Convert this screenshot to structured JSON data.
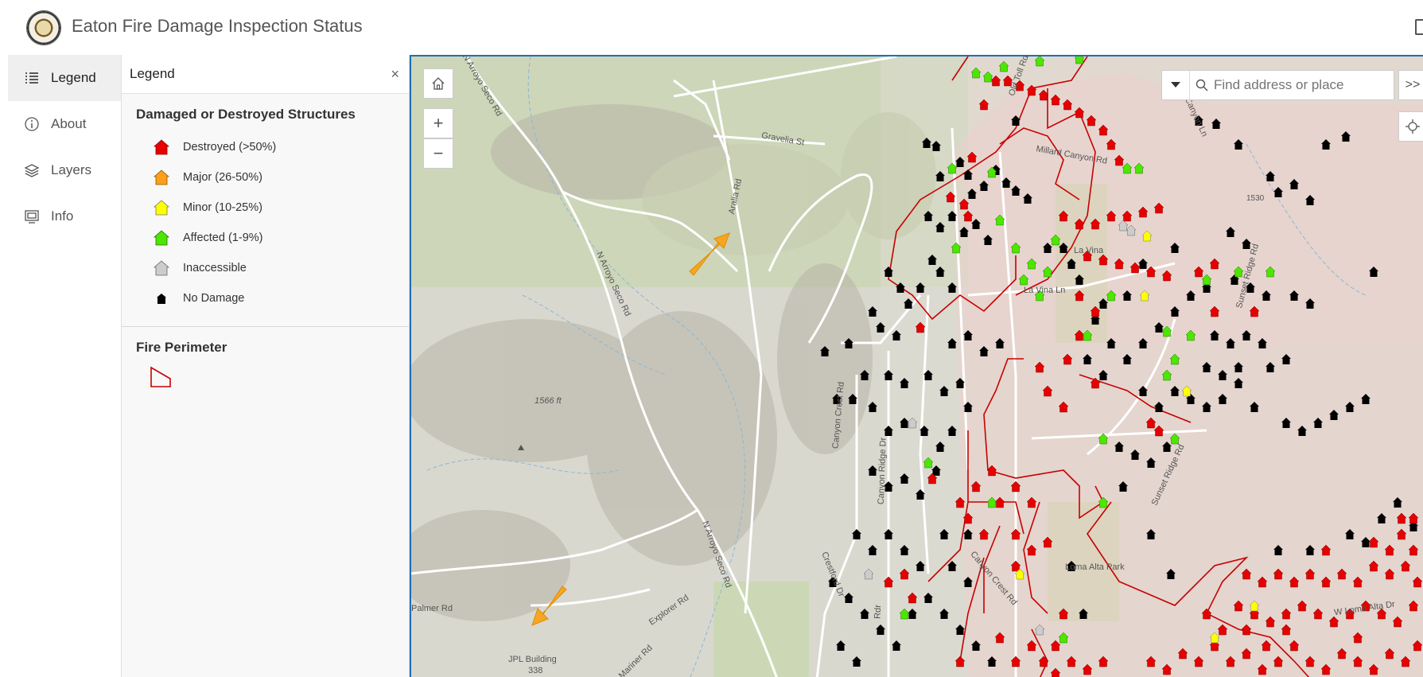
{
  "header": {
    "title": "Eaton Fire Damage Inspection Status"
  },
  "rail": {
    "items": [
      {
        "label": "Legend",
        "icon": "legend-list-icon",
        "active": true
      },
      {
        "label": "About",
        "icon": "info-circle-icon",
        "active": false
      },
      {
        "label": "Layers",
        "icon": "layers-icon",
        "active": false
      },
      {
        "label": "Info",
        "icon": "info-card-icon",
        "active": false
      }
    ]
  },
  "legend": {
    "title": "Legend",
    "close_label": "×",
    "damage_section": {
      "title": "Damaged or Destroyed Structures",
      "items": [
        {
          "label": "Destroyed (>50%)",
          "color": "#e60000"
        },
        {
          "label": "Major (26-50%)",
          "color": "#ff9f1a"
        },
        {
          "label": "Minor (10-25%)",
          "color": "#ffff00"
        },
        {
          "label": "Affected (1-9%)",
          "color": "#4ce600"
        },
        {
          "label": "Inaccessible",
          "color": "#cccccc"
        },
        {
          "label": "No Damage",
          "color": "#000000"
        }
      ]
    },
    "perimeter_section": {
      "title": "Fire Perimeter",
      "color": "#c80000"
    }
  },
  "map": {
    "search_placeholder": "Find address or place",
    "expand_label": ">>",
    "zoom_in": "+",
    "zoom_out": "−",
    "labels": {
      "gravelia": "Gravelia St",
      "aralia": "Aralia Rd",
      "arroyo_top": "N Arroyo Seco Rd",
      "arroyo_mid": "N Arroyo Seco Rd",
      "arroyo_bot": "N Arroyo Seco Rd",
      "old_toll": "Old Toll Rd",
      "canyon_ln": "Canyon Ln",
      "millard": "Millard Canyon Rd",
      "la_vina": "La Vina",
      "la_vina_ln": "La Vina Ln",
      "canyon_crest": "Canyon Crest Rd",
      "canyon_ridge": "Canyon Ridge Dr",
      "sunset_ridge": "Sunset Ridge Rd",
      "sunset_ridge_top": "Sunset Ridge Rd",
      "elev": "1566 ft",
      "jpl": "JPL Building",
      "jpl_num": "338",
      "explorer": "Explorer Rd",
      "mariner": "Mariner Rd",
      "crestford": "Crestford Dr",
      "loma_alta": "Loma Alta Park",
      "w_loma_alta": "W Loma Alta Dr",
      "canyon_crest2": "Canyon Crest Rd",
      "palmer": "Palmer Rd",
      "rdr": "Rdr",
      "num1530": "1530"
    }
  }
}
